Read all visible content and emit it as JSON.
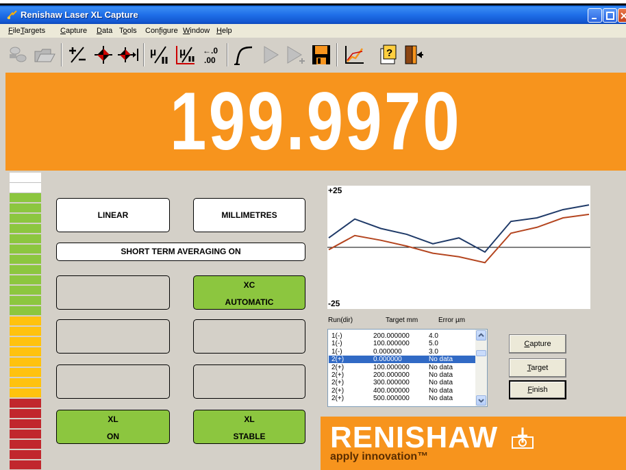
{
  "window": {
    "title": "Renishaw Laser XL Capture"
  },
  "menu": [
    {
      "pre": "",
      "u": "F",
      "post": "ile"
    },
    {
      "pre": "",
      "u": "T",
      "post": "argets"
    },
    {
      "pre": "",
      "u": "C",
      "post": "apture"
    },
    {
      "pre": "",
      "u": "D",
      "post": "ata"
    },
    {
      "pre": "T",
      "u": "o",
      "post": "ols"
    },
    {
      "pre": "Con",
      "u": "f",
      "post": "igure"
    },
    {
      "pre": "",
      "u": "W",
      "post": "indow"
    },
    {
      "pre": "",
      "u": "H",
      "post": "elp"
    }
  ],
  "toolbar": {
    "icons": [
      "connect-icon",
      "open-icon",
      "plus-minus-icon",
      "target-icon",
      "target-arrow-icon",
      "mu-slash-icon",
      "mu-axis-icon",
      "decimal-icon",
      "curve-icon",
      "play-icon",
      "play-plus-icon",
      "save-icon",
      "chart-icon",
      "help-icon",
      "exit-icon"
    ],
    "decimal_top": "←.0",
    "decimal_bottom": ".00"
  },
  "readout": {
    "value": "199.9970"
  },
  "status": {
    "mode": "LINEAR",
    "units": "MILLIMETRES",
    "averaging": "SHORT TERM AVERAGING ON",
    "xc_line1": "XC",
    "xc_line2": "AUTOMATIC",
    "xl_on_line1": "XL",
    "xl_on_line2": "ON",
    "xl_stable_line1": "XL",
    "xl_stable_line2": "STABLE"
  },
  "graph": {
    "top_label": "+25",
    "bottom_label": "-25",
    "series": [
      {
        "color": "#1f3a68",
        "values": [
          4.0,
          12.0,
          8.0,
          5.5,
          1.5,
          4.0,
          -2.0,
          11.0,
          12.5,
          16.0,
          18.0
        ]
      },
      {
        "color": "#b4451f",
        "values": [
          -1.0,
          5.0,
          3.0,
          0.5,
          -2.5,
          -4.0,
          -6.5,
          6.0,
          8.5,
          12.5,
          14.0
        ]
      }
    ]
  },
  "list": {
    "headers": {
      "run": "Run(dir)",
      "target": "Target mm",
      "error": "Error µm"
    },
    "rows": [
      {
        "run": "1(-)",
        "target": "200.000000",
        "error": "4.0",
        "selected": false
      },
      {
        "run": "1(-)",
        "target": "100.000000",
        "error": "5.0",
        "selected": false
      },
      {
        "run": "1(-)",
        "target": "0.000000",
        "error": "3.0",
        "selected": false
      },
      {
        "run": "2(+)",
        "target": "0.000000",
        "error": "No data",
        "selected": true
      },
      {
        "run": "2(+)",
        "target": "100.000000",
        "error": "No data",
        "selected": false
      },
      {
        "run": "2(+)",
        "target": "200.000000",
        "error": "No data",
        "selected": false
      },
      {
        "run": "2(+)",
        "target": "300.000000",
        "error": "No data",
        "selected": false
      },
      {
        "run": "2(+)",
        "target": "400.000000",
        "error": "No data",
        "selected": false
      },
      {
        "run": "2(+)",
        "target": "500.000000",
        "error": "No data",
        "selected": false
      }
    ]
  },
  "buttons": {
    "capture_u": "C",
    "capture_rest": "apture",
    "target_u": "T",
    "target_rest": "arget",
    "finish_u": "F",
    "finish_rest": "inish"
  },
  "logo": {
    "brand": "RENISHAW",
    "tagline": "apply innovation™"
  },
  "colors": {
    "accent": "#f7941d",
    "green": "#8cc63f",
    "titlebar": "#1f6fe8"
  }
}
